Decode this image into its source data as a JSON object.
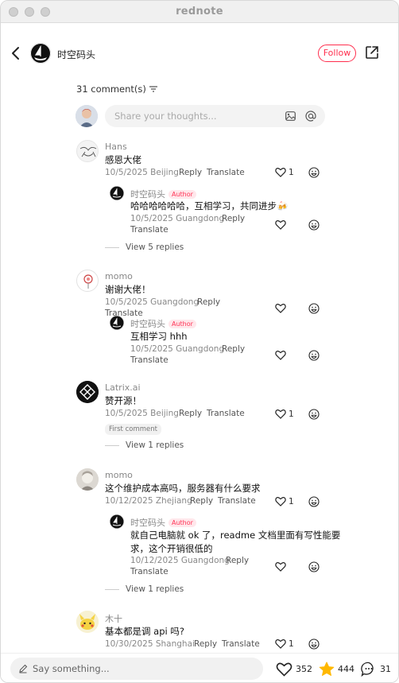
{
  "window": {
    "title": "rednote"
  },
  "header": {
    "author_name": "时空码头",
    "follow_label": "Follow"
  },
  "comments_header": {
    "count_label": "31 comment(s)"
  },
  "composer": {
    "placeholder": "Share your thoughts..."
  },
  "comments": [
    {
      "user": "Hans",
      "text": "感恩大佬",
      "date_loc": "10/5/2025 Beijing",
      "reply": "Reply",
      "translate": "Translate",
      "likes": "1",
      "replies": [
        {
          "user": "时空码头",
          "tag": "Author",
          "text": "哈哈哈哈哈哈，互相学习，共同进步🍻",
          "date_loc": "10/5/2025 Guangdong",
          "reply": "Reply",
          "translate": "Translate"
        }
      ],
      "view_more": "View 5 replies"
    },
    {
      "user": "momo",
      "text": "谢谢大佬！",
      "date_loc": "10/5/2025 Guangdong",
      "reply": "Reply",
      "translate": "Translate",
      "replies": [
        {
          "user": "时空码头",
          "tag": "Author",
          "text": "互相学习 hhh",
          "date_loc": "10/5/2025 Guangdong",
          "reply": "Reply",
          "translate": "Translate"
        }
      ]
    },
    {
      "user": "Latrix.ai",
      "text": "赞开源！",
      "date_loc": "10/5/2025 Beijing",
      "reply": "Reply",
      "translate": "Translate",
      "likes": "1",
      "badge": "First comment",
      "view_more": "View 1 replies"
    },
    {
      "user": "momo",
      "text": "这个维护成本高吗，服务器有什么要求",
      "date_loc": "10/12/2025 Zhejiang",
      "reply": "Reply",
      "translate": "Translate",
      "likes": "1",
      "replies": [
        {
          "user": "时空码头",
          "tag": "Author",
          "text_line1": "就自己电脑就 ok 了，readme 文档里面有写性能要",
          "text_line2": "求，这个开销很低的",
          "date_loc": "10/12/2025 Guangdong",
          "reply": "Reply",
          "translate": "Translate"
        }
      ],
      "view_more": "View 1 replies"
    },
    {
      "user": "木十",
      "text": "基本都是调 api 吗?",
      "date_loc": "10/30/2025 Shanghai",
      "reply": "Reply",
      "translate": "Translate",
      "likes": "1"
    }
  ],
  "bottom_bar": {
    "placeholder": "Say something...",
    "likes": "352",
    "stars": "444",
    "comments": "31"
  },
  "colors": {
    "accent": "#ff2e4d",
    "star": "#ffb800"
  },
  "icons": [
    "back-icon",
    "share-icon",
    "sort-icon",
    "image-icon",
    "at-icon",
    "heart-icon",
    "emoji-icon",
    "pencil-icon",
    "star-icon",
    "comment-icon"
  ]
}
